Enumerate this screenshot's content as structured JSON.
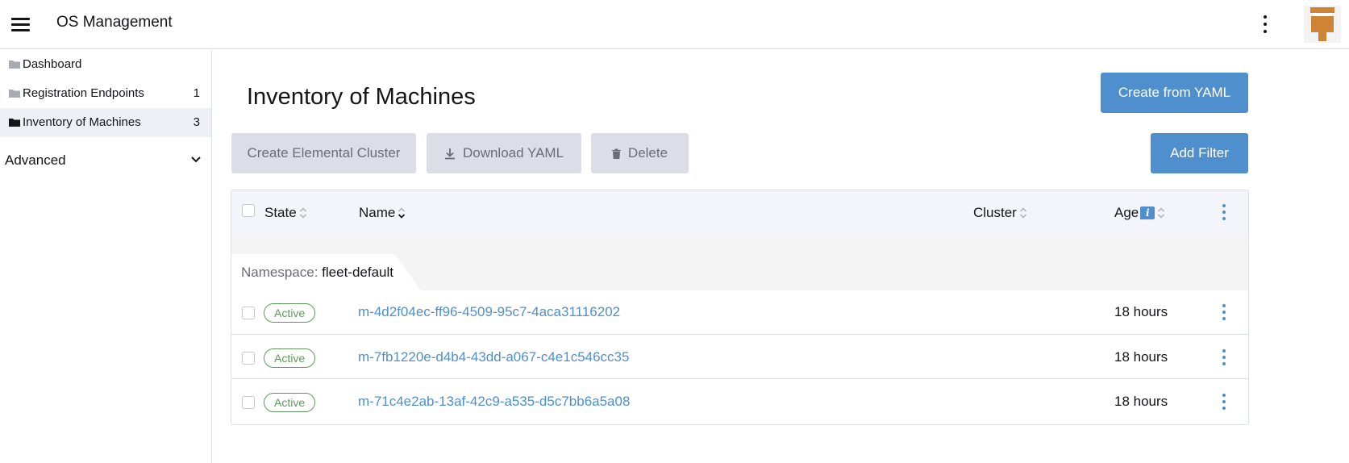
{
  "header": {
    "app_title": "OS Management",
    "menu_icon": "hamburger-menu-icon",
    "more_icon": "kebab-vertical-icon",
    "avatar_icon": "user-avatar-icon"
  },
  "sidebar": {
    "items": [
      {
        "label": "Dashboard",
        "count": "",
        "active": false,
        "icon": "folder-icon"
      },
      {
        "label": "Registration Endpoints",
        "count": "1",
        "active": false,
        "icon": "folder-icon"
      },
      {
        "label": "Inventory of Machines",
        "count": "3",
        "active": true,
        "icon": "folder-open-icon"
      }
    ],
    "group": {
      "label": "Advanced",
      "icon": "chevron-down-icon"
    }
  },
  "main": {
    "title": "Inventory of Machines",
    "create_yaml_label": "Create from YAML",
    "create_cluster_label": "Create Elemental Cluster",
    "download_yaml_label": "Download YAML",
    "delete_label": "Delete",
    "add_filter_label": "Add Filter"
  },
  "table": {
    "headers": {
      "state": "State",
      "name": "Name",
      "cluster": "Cluster",
      "age": "Age"
    },
    "age_info": "i",
    "group": {
      "key": "Namespace:",
      "value": "fleet-default"
    },
    "rows": [
      {
        "state": "Active",
        "name": "m-4d2f04ec-ff96-4509-95c7-4aca31116202",
        "cluster": "",
        "age": "18 hours"
      },
      {
        "state": "Active",
        "name": "m-7fb1220e-d4b4-43dd-a067-c4e1c546cc35",
        "cluster": "",
        "age": "18 hours"
      },
      {
        "state": "Active",
        "name": "m-71c4e2ab-13af-42c9-a535-d5c7bb6a5a08",
        "cluster": "",
        "age": "18 hours"
      }
    ]
  },
  "colors": {
    "accent": "#4f8fce",
    "success": "#5d995d",
    "disabled_bg": "#dcdee7",
    "avatar_orange": "#cf8435"
  }
}
